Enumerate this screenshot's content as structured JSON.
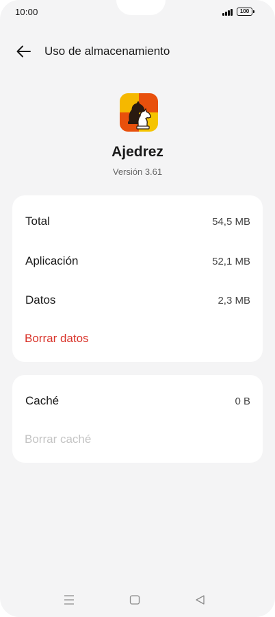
{
  "status": {
    "time": "10:00",
    "battery": "100"
  },
  "header": {
    "title": "Uso de almacenamiento"
  },
  "app": {
    "name": "Ajedrez",
    "version": "Versión 3.61"
  },
  "storage": {
    "rows": [
      {
        "label": "Total",
        "value": "54,5 MB"
      },
      {
        "label": "Aplicación",
        "value": "52,1 MB"
      },
      {
        "label": "Datos",
        "value": "2,3 MB"
      }
    ],
    "clear_data": "Borrar datos"
  },
  "cache": {
    "label": "Caché",
    "value": "0 B",
    "clear_cache": "Borrar caché"
  },
  "colors": {
    "accent_red": "#d9342b",
    "disabled": "#c4c4c4",
    "background": "#f4f4f5"
  },
  "icons": [
    "back-arrow-icon",
    "chess-knight-icon",
    "signal-icon",
    "battery-icon",
    "menu-icon",
    "home-icon",
    "back-triangle-icon"
  ]
}
